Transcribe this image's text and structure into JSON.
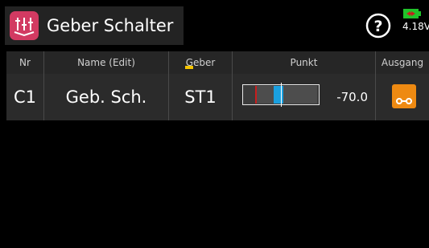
{
  "header": {
    "title": "Geber Schalter",
    "app_icon": "mixer-sliders-icon",
    "help_icon": "help-circle-icon",
    "battery": {
      "icon": "battery-icon",
      "voltage": "4.18V",
      "color": "#21c32a"
    }
  },
  "table": {
    "columns": [
      "Nr",
      "Name (Edit)",
      "Geber",
      "Punkt",
      "Ausgang"
    ],
    "rows": [
      {
        "nr": "C1",
        "name": "Geb. Sch.",
        "geber": "ST1",
        "punkt": {
          "value": "-70.0",
          "level_percent": -70
        },
        "ausgang": {
          "icon": "switch-icon",
          "color": "#ee8a12"
        }
      }
    ]
  },
  "colors": {
    "background": "#000000",
    "accent": "#d23a62",
    "cursor": "#f5c400",
    "marker": "#1aa0e0",
    "switch_point": "#c81e1e"
  }
}
